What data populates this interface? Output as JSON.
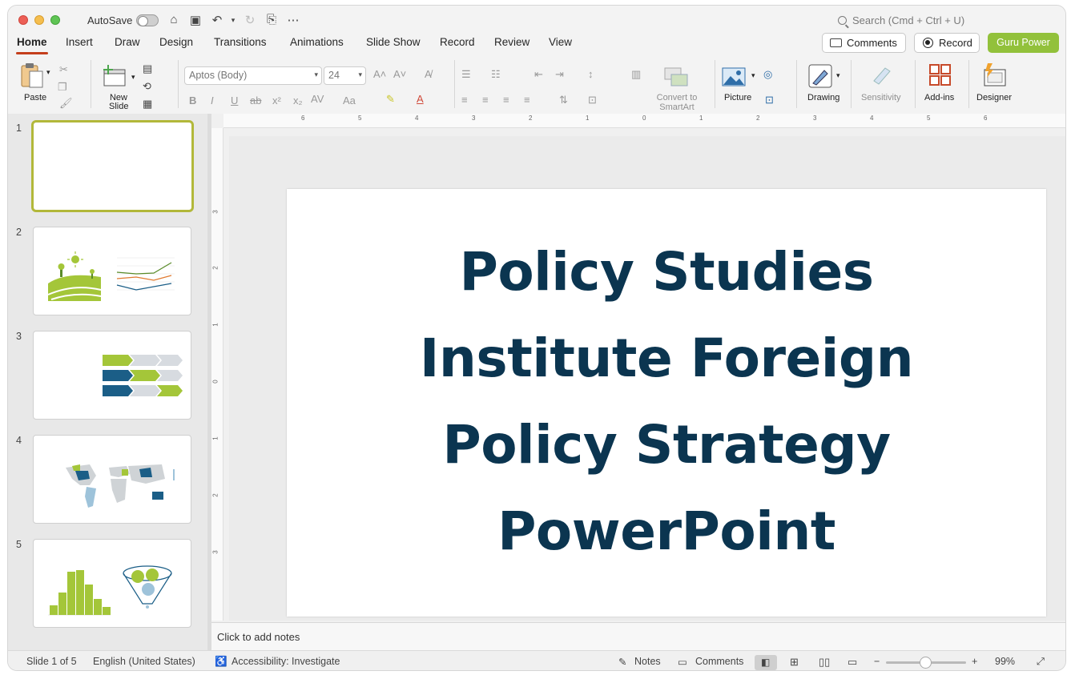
{
  "titlebar": {
    "autosave_label": "AutoSave",
    "search_placeholder": "Search (Cmd + Ctrl + U)"
  },
  "tabs": [
    "Home",
    "Insert",
    "Draw",
    "Design",
    "Transitions",
    "Animations",
    "Slide Show",
    "Record",
    "Review",
    "View"
  ],
  "active_tab": "Home",
  "header_buttons": {
    "comments": "Comments",
    "record": "Record",
    "guru": "Guru Power"
  },
  "ribbon": {
    "paste": "Paste",
    "new_slide": "New Slide",
    "font_name": "Aptos (Body)",
    "font_size": "24",
    "convert_smartart": "Convert to SmartArt",
    "picture": "Picture",
    "drawing": "Drawing",
    "sensitivity": "Sensitivity",
    "addins": "Add-ins",
    "designer": "Designer"
  },
  "thumbnails": [
    {
      "number": "1",
      "label": "Slide 1 (blank title slide)"
    },
    {
      "number": "2",
      "label": "Farm illustration with line chart"
    },
    {
      "number": "3",
      "label": "Arrow process diagram"
    },
    {
      "number": "4",
      "label": "World map chart"
    },
    {
      "number": "5",
      "label": "Histogram with funnel"
    }
  ],
  "slide": {
    "title_lines": [
      "Policy Studies",
      "Institute Foreign",
      "Policy Strategy",
      "PowerPoint"
    ]
  },
  "notes_placeholder": "Click to add notes",
  "status": {
    "slide_count": "Slide 1 of 5",
    "language": "English (United States)",
    "accessibility": "Accessibility: Investigate",
    "notes": "Notes",
    "comments": "Comments",
    "zoom": "99%"
  },
  "colors": {
    "accent_red": "#c43e1c",
    "guru_green": "#92c13b",
    "title_navy": "#0b3550",
    "thumb_green": "#a4c639",
    "thumb_blue": "#1b5e87"
  }
}
